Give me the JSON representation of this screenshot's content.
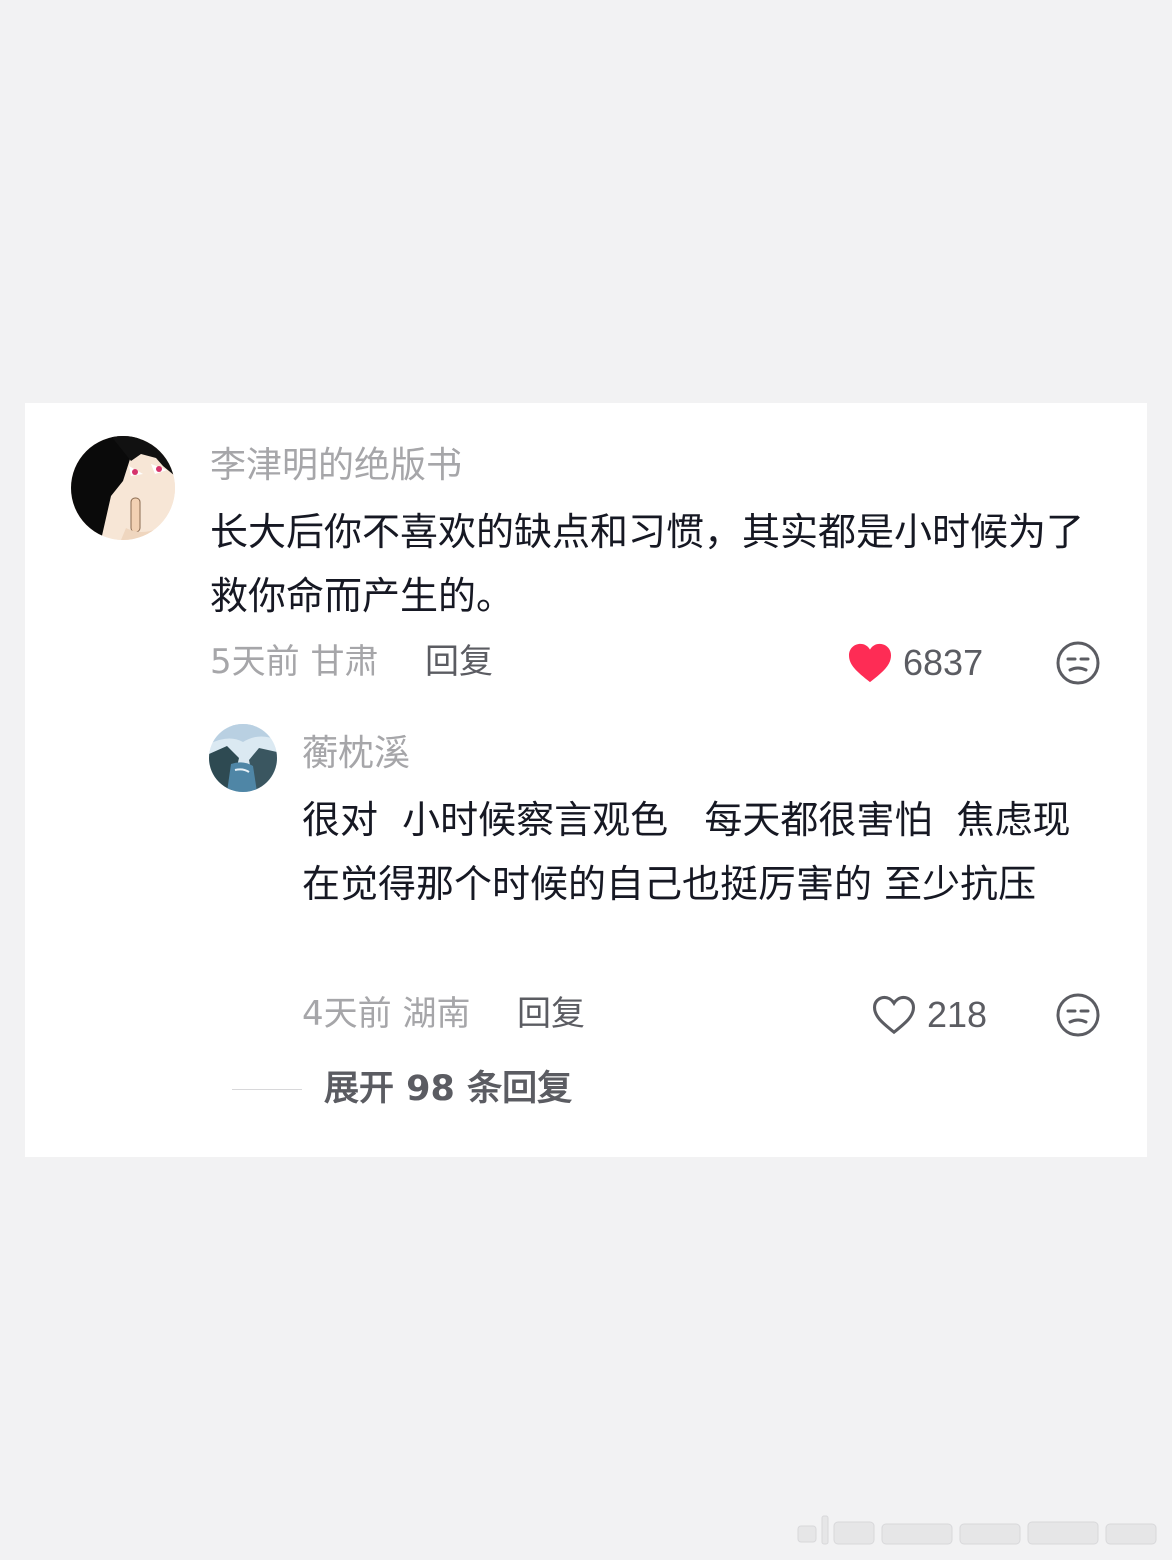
{
  "comments": [
    {
      "username": "李津明的绝版书",
      "text": "长大后你不喜欢的缺点和习惯，其实都是小时候为了救你命而产生的。",
      "meta": "5天前 甘肃",
      "reply_label": "回复",
      "likes": "6837",
      "liked": true,
      "avatar_icon": "anime-character-avatar",
      "emoji_icon": "sleepy-face-emoji-icon"
    },
    {
      "username": "蘅枕溪",
      "text": "很对  小时候察言观色   每天都很害怕  焦虑现在觉得那个时候的自己也挺厉害的 至少抗压",
      "meta": "4天前 湖南",
      "reply_label": "回复",
      "likes": "218",
      "liked": false,
      "avatar_icon": "lake-landscape-avatar",
      "emoji_icon": "sleepy-face-emoji-icon"
    }
  ],
  "expand_replies": "展开 98 条回复",
  "colors": {
    "background": "#f2f2f3",
    "card": "#ffffff",
    "heart_active": "#fe2c55",
    "text_primary": "#161823",
    "text_secondary": "#a6a6a9"
  }
}
